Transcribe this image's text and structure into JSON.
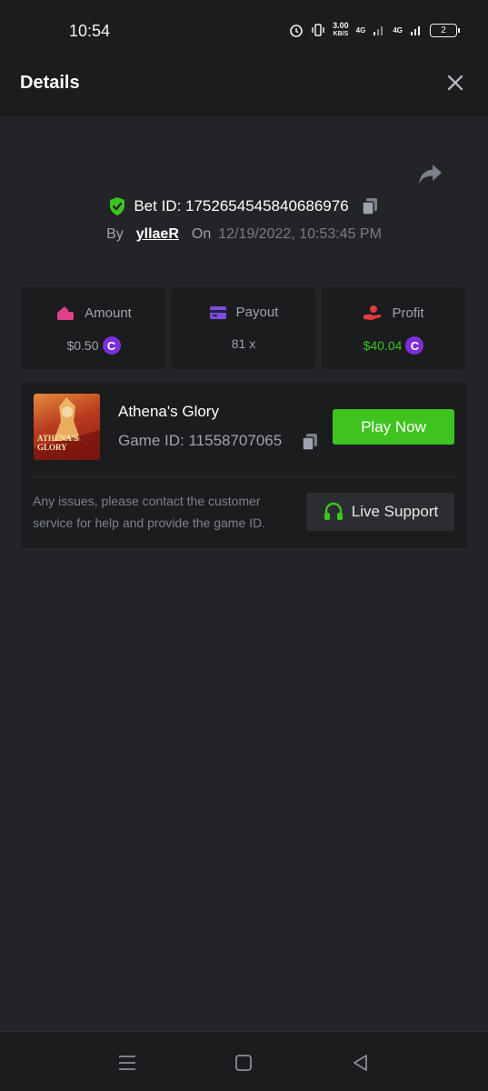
{
  "status_bar": {
    "time": "10:54",
    "speed_value": "3.00",
    "speed_unit": "KB/S",
    "network_1": "4G",
    "network_2": "4G",
    "battery": "2"
  },
  "header": {
    "title": "Details",
    "close_icon": "close-icon"
  },
  "bet": {
    "verified_icon": "shield-check-icon",
    "id_label": "Bet ID: 1752654545840686976",
    "by_label": "By",
    "username": "yllaeR",
    "on_label": "On",
    "date": "12/19/2022, 10:53:45 PM"
  },
  "stats": [
    {
      "label": "Amount",
      "value": "$0.50",
      "icon": "wallet-icon",
      "icon_color": "#e0408a",
      "value_color": "#9ea3ad"
    },
    {
      "label": "Payout",
      "value": "81 x",
      "icon": "card-icon",
      "icon_color": "#7c4ddc",
      "value_color": "#9ea3ad"
    },
    {
      "label": "Profit",
      "value": "$40.04",
      "icon": "hand-coin-icon",
      "icon_color": "#e03c3c",
      "value_color": "#3ec31f"
    }
  ],
  "coin_symbol": "C",
  "game": {
    "name": "Athena's Glory",
    "id_label": "Game ID: 11558707065",
    "thumb_text_line1": "ATHENA'S",
    "thumb_text_line2": "GLORY",
    "play_button": "Play Now",
    "support_text": "Any issues, please contact the customer service for help and provide the game ID.",
    "support_button": "Live Support"
  },
  "colors": {
    "accent_green": "#3ec31f",
    "background": "#232427",
    "card": "#1b1c1e"
  }
}
